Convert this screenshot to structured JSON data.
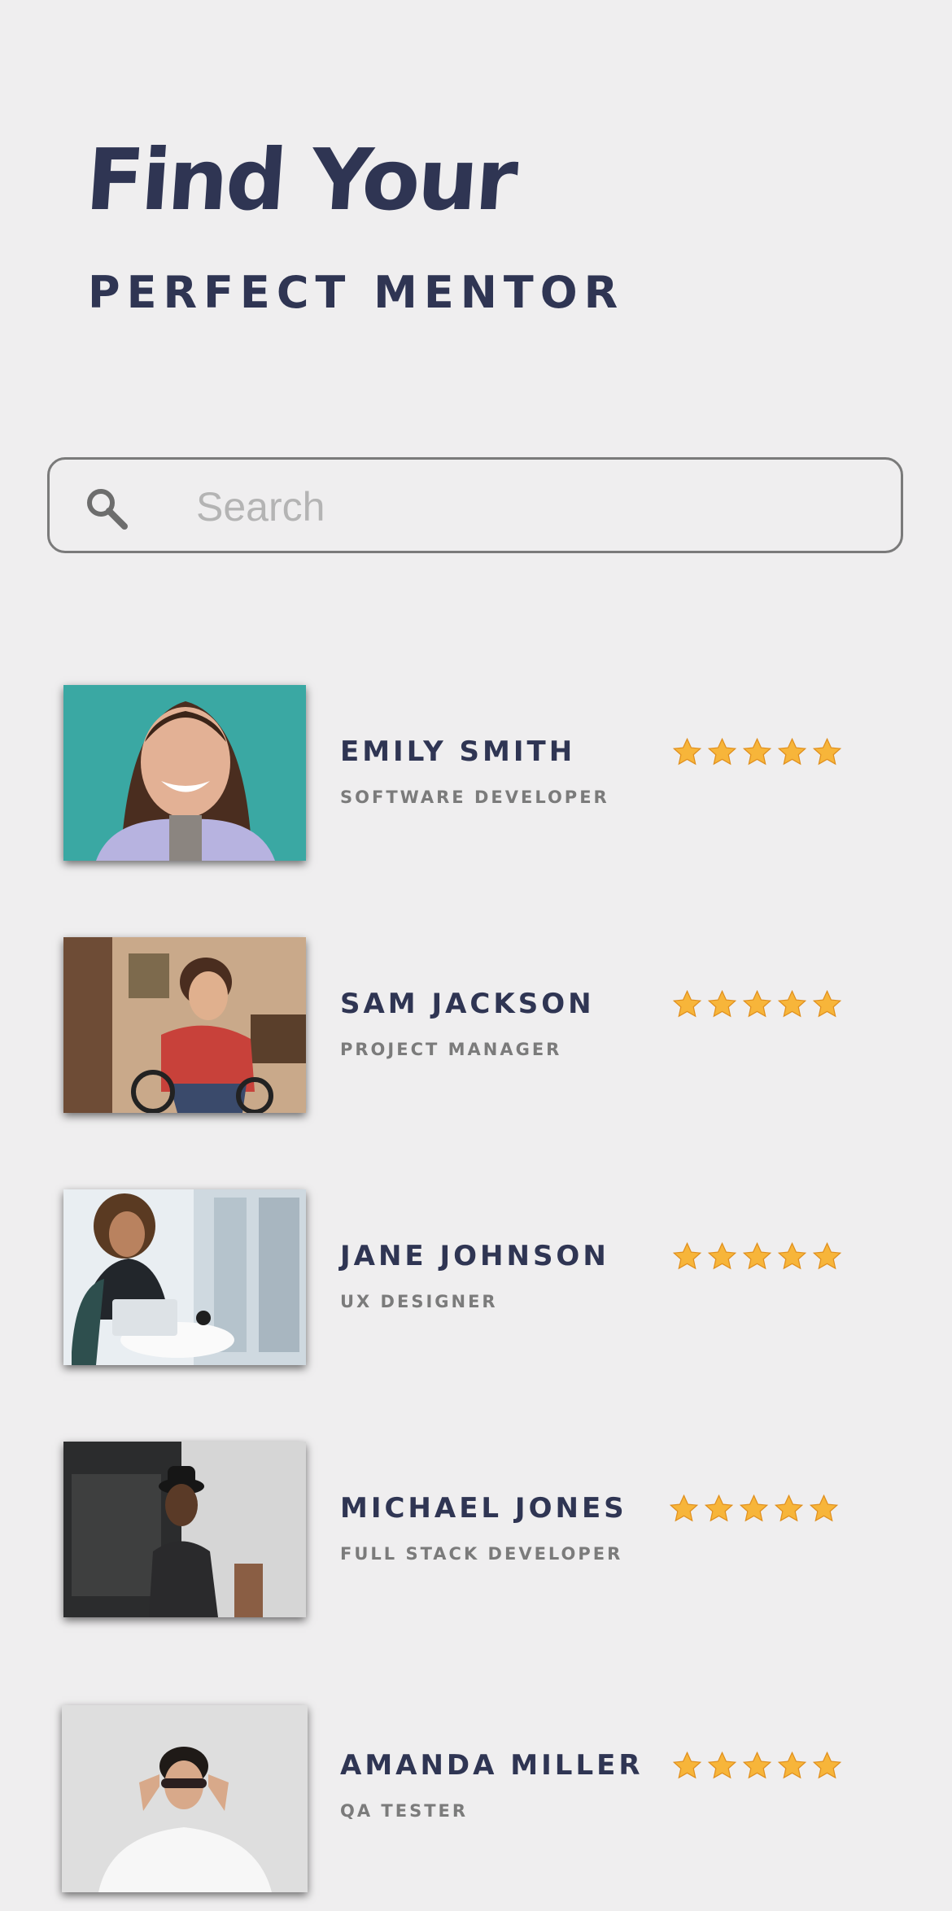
{
  "header": {
    "title": "Find Your",
    "subtitle": "PERFECT MENTOR"
  },
  "search": {
    "placeholder": "Search",
    "value": ""
  },
  "colors": {
    "background": "#efeeef",
    "heading": "#2f3553",
    "role_text": "#7b7b7b",
    "star": "#f7b53a"
  },
  "mentors": [
    {
      "name": "EMILY SMITH",
      "role": "SOFTWARE DEVELOPER",
      "rating": 5,
      "photo_icon": "portrait-photo"
    },
    {
      "name": "SAM JACKSON",
      "role": "PROJECT MANAGER",
      "rating": 5,
      "photo_icon": "portrait-photo"
    },
    {
      "name": "JANE JOHNSON",
      "role": "UX DESIGNER",
      "rating": 5,
      "photo_icon": "portrait-photo"
    },
    {
      "name": "MICHAEL JONES",
      "role": "FULL STACK DEVELOPER",
      "rating": 5,
      "photo_icon": "portrait-photo"
    },
    {
      "name": "AMANDA MILLER",
      "role": "QA TESTER",
      "rating": 5,
      "photo_icon": "portrait-photo"
    }
  ]
}
